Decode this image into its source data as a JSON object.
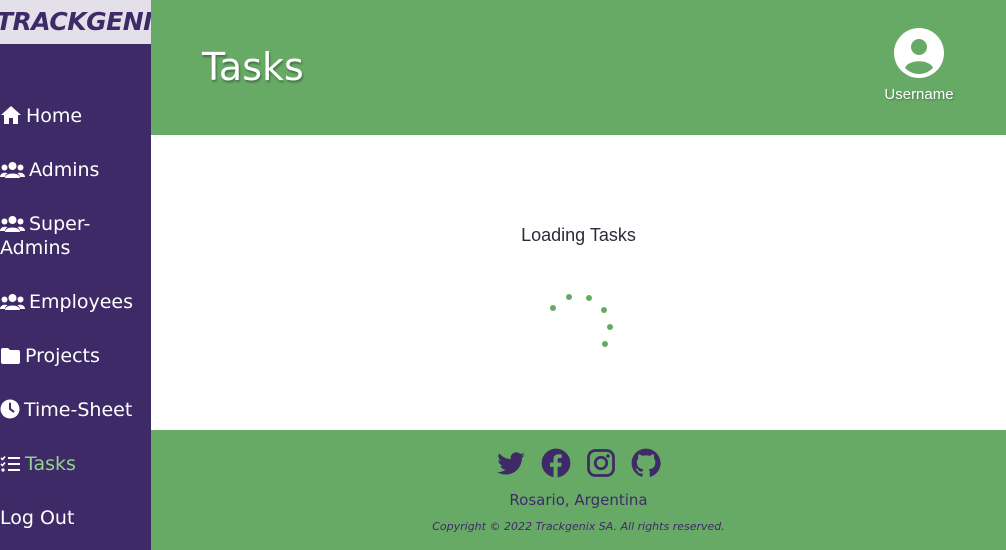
{
  "brand": {
    "logo_text": "TRACKGENIX"
  },
  "sidebar": {
    "items": [
      {
        "label": "Home",
        "icon": "home-icon",
        "active": false
      },
      {
        "label": "Admins",
        "icon": "users-icon",
        "active": false
      },
      {
        "label": "Super-Admins",
        "icon": "users-icon",
        "active": false
      },
      {
        "label": "Employees",
        "icon": "users-icon",
        "active": false
      },
      {
        "label": "Projects",
        "icon": "folder-icon",
        "active": false
      },
      {
        "label": "Time-Sheet",
        "icon": "clock-icon",
        "active": false
      },
      {
        "label": "Tasks",
        "icon": "tasks-icon",
        "active": true
      },
      {
        "label": "Log Out",
        "icon": "",
        "active": false
      }
    ]
  },
  "header": {
    "title": "Tasks",
    "user": {
      "name": "Username",
      "icon": "user-circle-icon"
    }
  },
  "main": {
    "loading_text": "Loading Tasks",
    "spinner_icon": "loading-spinner-icon"
  },
  "footer": {
    "social_icons": [
      "twitter-icon",
      "facebook-icon",
      "instagram-icon",
      "github-icon"
    ],
    "location": "Rosario, Argentina",
    "copyright": "Copyright © 2022 Trackgenix SA. All rights reserved."
  },
  "colors": {
    "sidebar_bg": "#3f2a68",
    "header_bg": "#67aa66",
    "active_nav": "#8fd48b",
    "logo_bg": "#e3e0ea"
  }
}
